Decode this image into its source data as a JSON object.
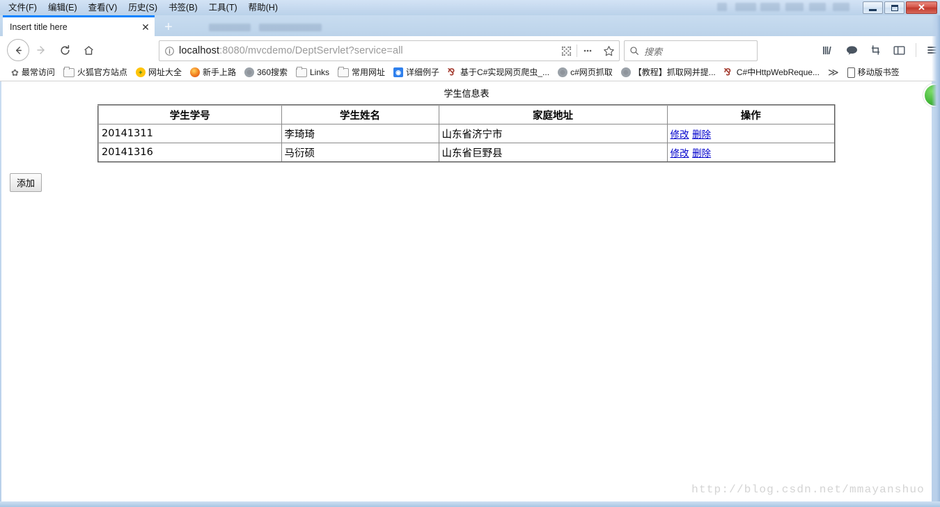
{
  "window": {
    "minimize_label": "Minimize",
    "maximize_label": "Maximize",
    "close_label": "✕"
  },
  "menubar": {
    "items": [
      {
        "label": "文件(F)"
      },
      {
        "label": "编辑(E)"
      },
      {
        "label": "查看(V)"
      },
      {
        "label": "历史(S)"
      },
      {
        "label": "书签(B)"
      },
      {
        "label": "工具(T)"
      },
      {
        "label": "帮助(H)"
      }
    ]
  },
  "tabs": {
    "active": {
      "title": "Insert title here",
      "close_label": "✕"
    },
    "newtab_label": "+"
  },
  "navigation": {
    "back_label": "←",
    "forward_label": "→",
    "reload_label": "⟳",
    "home_label": "⌂"
  },
  "address_bar": {
    "url_host": "localhost",
    "url_rest": ":8080/mvcdemo/DeptServlet?service=all",
    "full_url": "localhost:8080/mvcdemo/DeptServlet?service=all",
    "info_icon": "info-icon",
    "reader_icon": "qr-code-icon",
    "more_icon": "ellipsis-icon",
    "bookmark_icon": "star-icon"
  },
  "search_bar": {
    "placeholder": "搜索",
    "icon": "search-icon"
  },
  "toolbar_icons": [
    {
      "name": "library-icon",
      "glyph": "|||\\"
    },
    {
      "name": "chat-bubble-icon",
      "glyph": "💬"
    },
    {
      "name": "screenshot-icon",
      "glyph": "⛶"
    },
    {
      "name": "sidebar-icon",
      "glyph": "▤"
    },
    {
      "name": "hamburger-menu-icon",
      "glyph": "☰"
    }
  ],
  "bookmarks": {
    "items": [
      {
        "label": "最常访问",
        "icon": "gear-icon",
        "color": "#6f6f6f"
      },
      {
        "label": "火狐官方站点",
        "icon": "folder-icon",
        "color": "#9b9b9b"
      },
      {
        "label": "网址大全",
        "icon": "plus-circle-icon",
        "color": "#f0b400"
      },
      {
        "label": "新手上路",
        "icon": "firefox-icon",
        "color": "#e8630a"
      },
      {
        "label": "360搜索",
        "icon": "globe-icon",
        "color": "#8b9097"
      },
      {
        "label": "Links",
        "icon": "folder-icon",
        "color": "#9b9b9b"
      },
      {
        "label": "常用网址",
        "icon": "folder-icon",
        "color": "#9b9b9b"
      },
      {
        "label": "详细例子",
        "icon": "blue-globe-icon",
        "color": "#2f80ed"
      },
      {
        "label": "基于C#实现网页爬虫_...",
        "icon": "blog-icon",
        "color": "#a33a2e"
      },
      {
        "label": "c#网页抓取",
        "icon": "globe-icon",
        "color": "#8b9097"
      },
      {
        "label": "【教程】抓取网并提...",
        "icon": "globe-icon",
        "color": "#8b9097"
      },
      {
        "label": "C#中HttpWebReque...",
        "icon": "blog-icon",
        "color": "#a33a2e"
      }
    ],
    "overflow_label": "≫",
    "mobile_label": "移动版书签"
  },
  "page": {
    "title": "学生信息表",
    "table": {
      "headers": [
        "学生学号",
        "学生姓名",
        "家庭地址",
        "操作"
      ],
      "rows": [
        {
          "id": "20141311",
          "name": "李琦琦",
          "address": "山东省济宁市",
          "edit_label": "修改",
          "delete_label": "删除"
        },
        {
          "id": "20141316",
          "name": "马衍硕",
          "address": "山东省巨野县",
          "edit_label": "修改",
          "delete_label": "删除"
        }
      ]
    },
    "add_button_label": "添加",
    "watermark": "http://blog.csdn.net/mmayanshuo"
  }
}
